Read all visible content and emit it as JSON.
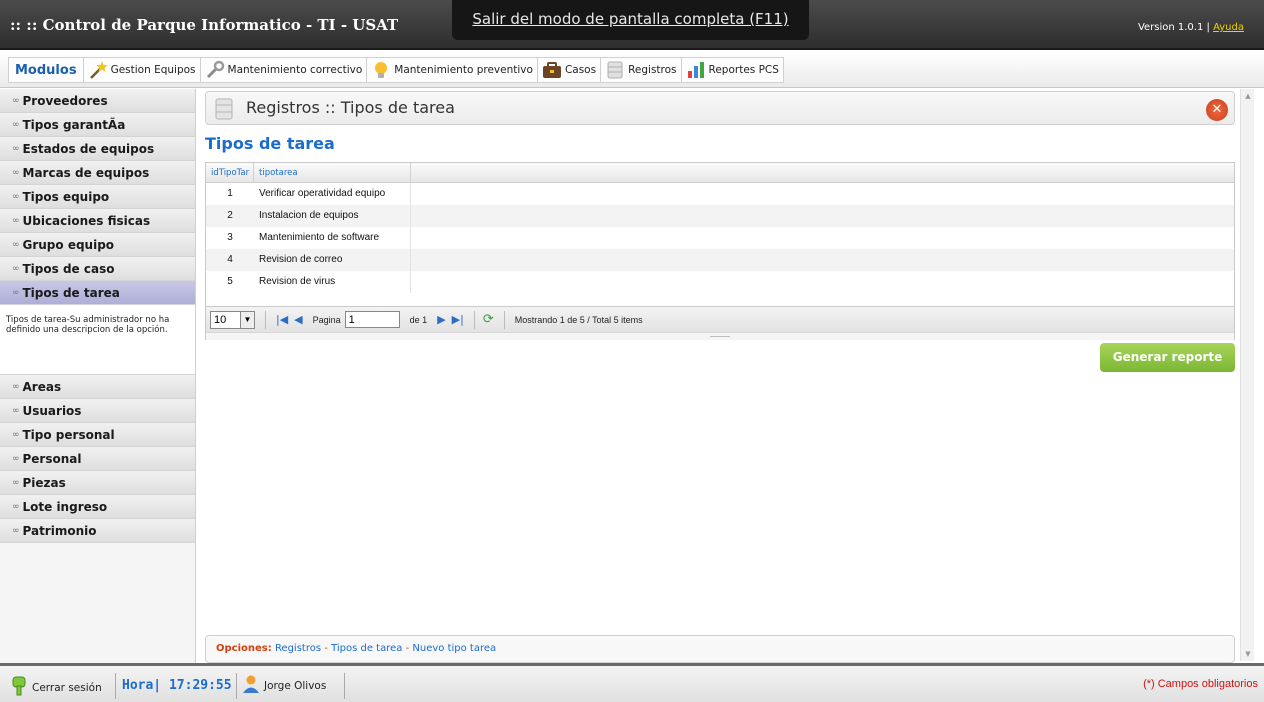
{
  "header": {
    "title": ":: :: Control de Parque Informatico - TI - USAT",
    "fullscreen_banner": "Salir del modo de pantalla completa (F11)",
    "version": "Version 1.0.1",
    "version_sep": "|",
    "help_link": "Ayuda"
  },
  "modules": {
    "title": "Modulos",
    "items": [
      {
        "label": "Gestion Equipos",
        "icon": "magic-wand-icon"
      },
      {
        "label": "Mantenimiento correctivo",
        "icon": "wrench-icon"
      },
      {
        "label": "Mantenimiento preventivo",
        "icon": "lightbulb-icon"
      },
      {
        "label": "Casos",
        "icon": "briefcase-icon"
      },
      {
        "label": "Registros",
        "icon": "database-icon"
      },
      {
        "label": "Reportes PCS",
        "icon": "bar-chart-icon"
      }
    ]
  },
  "sidebar": {
    "items_top": [
      {
        "label": "Proveedores"
      },
      {
        "label": "Tipos garantÃa"
      },
      {
        "label": "Estados de equipos"
      },
      {
        "label": "Marcas de equipos"
      },
      {
        "label": "Tipos equipo"
      },
      {
        "label": "Ubicaciones fisicas"
      },
      {
        "label": "Grupo equipo"
      },
      {
        "label": "Tipos de caso"
      },
      {
        "label": "Tipos de tarea",
        "active": true
      }
    ],
    "description": "Tipos de tarea-Su administrador no ha definido una descripcion de la opción.",
    "items_bottom": [
      {
        "label": "Areas"
      },
      {
        "label": "Usuarios"
      },
      {
        "label": "Tipo personal"
      },
      {
        "label": "Personal"
      },
      {
        "label": "Piezas"
      },
      {
        "label": "Lote ingreso"
      },
      {
        "label": "Patrimonio"
      }
    ]
  },
  "main": {
    "panel_title": "Registros :: Tipos de tarea",
    "section_title": "Tipos de tarea",
    "grid": {
      "columns": [
        "idTipoTar",
        "tipotarea"
      ],
      "rows": [
        {
          "id": "1",
          "tipotarea": "Verificar operatividad equipo"
        },
        {
          "id": "2",
          "tipotarea": "Instalacion de equipos"
        },
        {
          "id": "3",
          "tipotarea": "Mantenimiento de software"
        },
        {
          "id": "4",
          "tipotarea": "Revision de correo"
        },
        {
          "id": "5",
          "tipotarea": "Revision de virus"
        }
      ]
    },
    "pager": {
      "rows_per_page": "10",
      "page_label": "Pagina",
      "page_value": "1",
      "of_label": "de 1",
      "status": "Mostrando 1 de 5 / Total 5 items"
    },
    "report_button": "Generar reporte",
    "options": {
      "label": "Opciones:",
      "links": [
        "Registros",
        "Tipos de tarea",
        "Nuevo tipo tarea"
      ],
      "separator": "-"
    }
  },
  "footer": {
    "logout": "Cerrar sesión",
    "hora_label": "Hora|",
    "hora_value": "17:29:55",
    "user": "Jorge Olivos",
    "required_note": "(*) Campos obligatorios"
  },
  "colors": {
    "accent_blue": "#1a6ccf",
    "report_green": "#7cb634",
    "close_red": "#d04a20",
    "active_item": "#b8b8dc"
  }
}
